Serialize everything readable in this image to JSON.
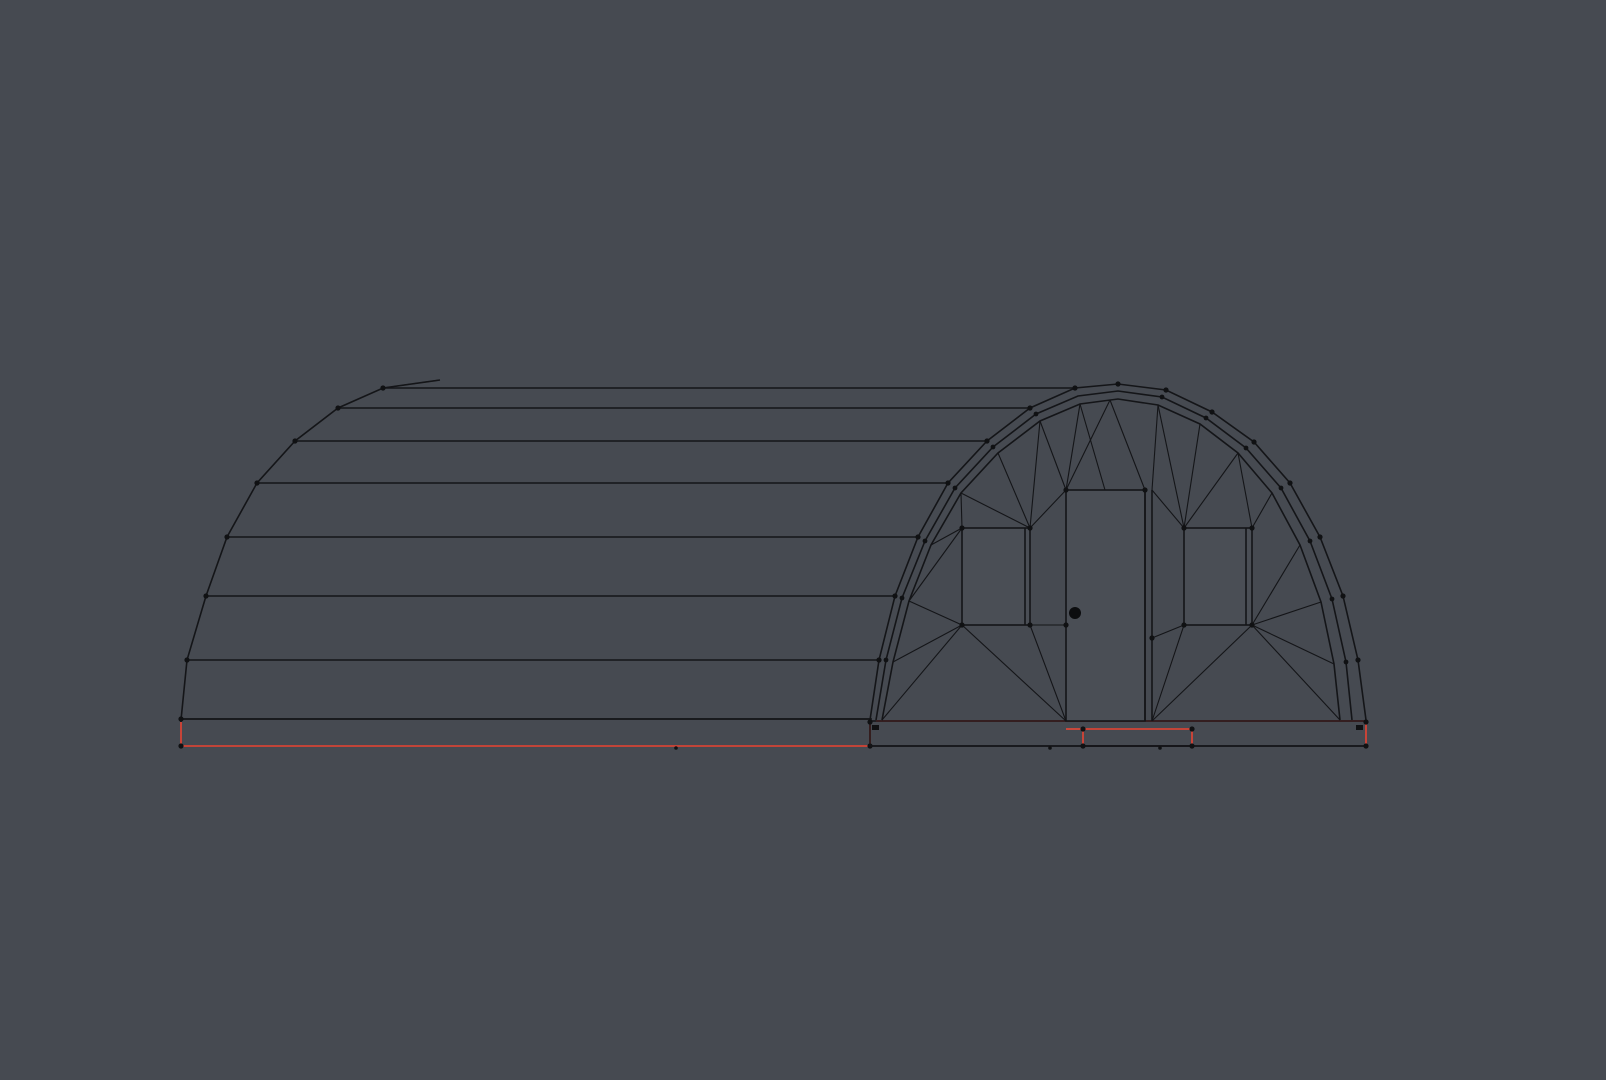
{
  "viewport": {
    "background_color": "#464a51",
    "wire_color": "#141518",
    "selected_edge_color": "#d9483a",
    "object": "quonset-hut-mesh",
    "mode": "wireframe-edit"
  }
}
